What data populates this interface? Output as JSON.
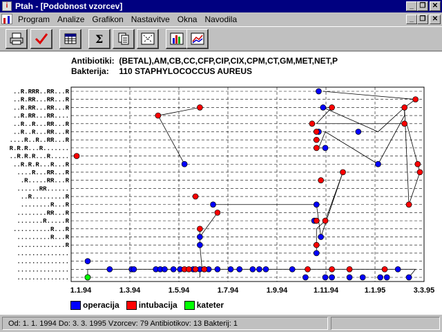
{
  "window": {
    "title": "Ptah - [Podobnost vzorcev]"
  },
  "menu": [
    "Program",
    "Analize",
    "Grafikon",
    "Nastavitve",
    "Okna",
    "Navodila"
  ],
  "toolbar_icons": [
    "printer-icon",
    "checkmark-icon",
    "calculator-icon",
    "sigma-icon",
    "document-icon",
    "scatter-icon",
    "bar-chart-icon",
    "line-chart-icon"
  ],
  "info": {
    "antibiotics_label": "Antibiotiki:",
    "antibiotics_value": "(BETAL),AM,CB,CC,CFP,CIP,CIX,CPM,CT,GM,MET,NET,P",
    "bacteria_label": "Bakterija:",
    "bacteria_value": "110 STAPHYLOCOCCUS AUREUS"
  },
  "chart_data": {
    "type": "scatter",
    "title": "",
    "xlabel": "",
    "ylabel": "",
    "x_tick_labels": [
      "1.1.94",
      "1.3.94",
      "1.5.94",
      "1.7.94",
      "1.9.94",
      "1.11.94",
      "1.1.95",
      "3.3.95"
    ],
    "y_row_labels": [
      "..R.RRR..RR...R",
      "..R.RR...RR...R",
      "..R.RR...RR...R",
      "..R.RR...RR....",
      "..R..R...RR...R",
      "..R..R...RR...R",
      "....R..R..RR...R",
      "R.R.R...R.......",
      "..R.R.R...R.....",
      "..R.R.R...R...R",
      "....R...RR...R",
      ".R.....RR...R",
      "......RR......",
      "..R.........R",
      "........R...R",
      "........RR...R",
      ".......R.....R",
      "..........R...R",
      ".........R...R",
      ".............R",
      "..............",
      "..............",
      "..............",
      ".............."
    ],
    "grid": true,
    "legend_position": "bottom-left",
    "colors": {
      "operacija": "#0000ff",
      "intubacija": "#ff0000",
      "kateter": "#00ff00"
    },
    "series": [
      {
        "name": "operacija",
        "points": [
          [
            0.5,
            23.0
          ],
          [
            0.5,
            21.0
          ],
          [
            1.5,
            22.0
          ],
          [
            2.5,
            22.0
          ],
          [
            2.6,
            22.0
          ],
          [
            3.6,
            22.0
          ],
          [
            3.8,
            22.0
          ],
          [
            4.0,
            22.0
          ],
          [
            4.4,
            22.0
          ],
          [
            4.7,
            22.0
          ],
          [
            5.3,
            22.0
          ],
          [
            5.6,
            22.0
          ],
          [
            6.0,
            22.0
          ],
          [
            6.4,
            22.0
          ],
          [
            7.0,
            22.0
          ],
          [
            7.4,
            22.0
          ],
          [
            8.0,
            22.0
          ],
          [
            8.3,
            22.0
          ],
          [
            8.6,
            22.0
          ],
          [
            9.8,
            22.0
          ],
          [
            10.4,
            23.0
          ],
          [
            11.3,
            23.0
          ],
          [
            11.6,
            23.0
          ],
          [
            12.4,
            23.0
          ],
          [
            13.0,
            23.0
          ],
          [
            13.8,
            23.0
          ],
          [
            14.1,
            23.0
          ],
          [
            14.6,
            22.0
          ],
          [
            15.1,
            23.0
          ],
          [
            11.0,
            0.0
          ],
          [
            11.2,
            2.0
          ],
          [
            12.8,
            5.0
          ],
          [
            13.7,
            9.0
          ],
          [
            11.3,
            7.0
          ],
          [
            11.0,
            5.0
          ],
          [
            10.9,
            14.0
          ],
          [
            6.2,
            14.0
          ],
          [
            4.9,
            9.0
          ],
          [
            5.6,
            19.0
          ],
          [
            5.6,
            18.0
          ],
          [
            11.1,
            18.0
          ],
          [
            10.9,
            20.0
          ],
          [
            10.8,
            16.0
          ],
          [
            5.8,
            22.0
          ]
        ]
      },
      {
        "name": "intubacija",
        "points": [
          [
            15.4,
            1.0
          ],
          [
            14.9,
            2.0
          ],
          [
            14.9,
            4.0
          ],
          [
            15.5,
            9.0
          ],
          [
            15.1,
            14.0
          ],
          [
            15.6,
            10.0
          ],
          [
            11.6,
            2.0
          ],
          [
            10.7,
            4.0
          ],
          [
            10.9,
            6.0
          ],
          [
            10.9,
            7.0
          ],
          [
            10.9,
            5.0
          ],
          [
            12.1,
            10.0
          ],
          [
            11.1,
            11.0
          ],
          [
            10.9,
            16.0
          ],
          [
            11.3,
            16.0
          ],
          [
            5.6,
            2.0
          ],
          [
            3.7,
            3.0
          ],
          [
            5.4,
            13.0
          ],
          [
            6.4,
            15.0
          ],
          [
            5.6,
            17.0
          ],
          [
            0.0,
            8.0
          ],
          [
            10.9,
            19.0
          ],
          [
            4.9,
            22.0
          ],
          [
            5.1,
            22.0
          ],
          [
            5.4,
            22.0
          ],
          [
            5.8,
            22.0
          ],
          [
            11.6,
            22.0
          ],
          [
            12.4,
            22.0
          ],
          [
            14.0,
            22.0
          ],
          [
            10.5,
            22.0
          ]
        ]
      },
      {
        "name": "kateter",
        "points": [
          [
            0.5,
            23.0
          ]
        ]
      }
    ],
    "polyline_connections": [
      [
        [
          11.2,
          0.0
        ],
        [
          15.4,
          1.0
        ],
        [
          14.9,
          2.0
        ],
        [
          13.7,
          5.0
        ],
        [
          11.2,
          2.0
        ],
        [
          11.6,
          2.0
        ],
        [
          10.9,
          4.0
        ],
        [
          15.0,
          4.0
        ],
        [
          15.5,
          9.0
        ],
        [
          15.6,
          10.0
        ],
        [
          15.1,
          14.0
        ],
        [
          14.9,
          2.0
        ],
        [
          14.9,
          3.0
        ],
        [
          13.7,
          9.0
        ],
        [
          11.3,
          5.0
        ],
        [
          11.0,
          7.0
        ],
        [
          11.3,
          7.0
        ]
      ],
      [
        [
          5.6,
          2.0
        ],
        [
          3.7,
          3.0
        ],
        [
          4.9,
          9.0
        ]
      ],
      [
        [
          6.2,
          14.0
        ],
        [
          10.9,
          14.0
        ],
        [
          11.0,
          16.0
        ],
        [
          11.1,
          18.0
        ],
        [
          12.1,
          10.0
        ],
        [
          11.3,
          16.0
        ],
        [
          10.9,
          17.0
        ],
        [
          10.9,
          19.0
        ],
        [
          10.9,
          20.0
        ]
      ],
      [
        [
          5.6,
          17.0
        ],
        [
          5.6,
          18.0
        ],
        [
          5.6,
          19.0
        ],
        [
          5.7,
          22.0
        ],
        [
          5.6,
          22.0
        ],
        [
          5.6,
          23.0
        ]
      ],
      [
        [
          0.5,
          23.0
        ],
        [
          0.5,
          22.0
        ],
        [
          15.4,
          22.0
        ],
        [
          15.1,
          23.0
        ]
      ],
      [
        [
          5.6,
          18.0
        ],
        [
          6.4,
          15.0
        ]
      ]
    ]
  },
  "legend": [
    {
      "label": "operacija",
      "color": "#0000ff"
    },
    {
      "label": "intubacija",
      "color": "#ff0000"
    },
    {
      "label": "kateter",
      "color": "#00ff00"
    }
  ],
  "status": {
    "text": "Od: 1. 1. 1994  Do: 3. 3. 1995  Vzorcev: 79  Antibiotikov: 13  Bakterij: 1"
  }
}
